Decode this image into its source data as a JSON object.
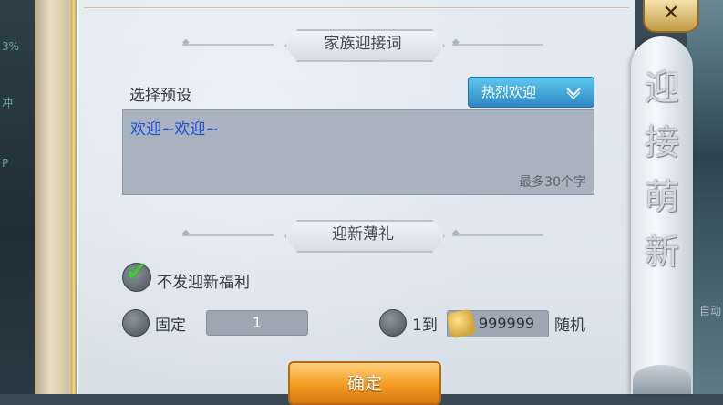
{
  "background": {
    "left_fragments": [
      "3%",
      "冲",
      "P"
    ],
    "right_fragment": "自动"
  },
  "close_glyph": "✕",
  "scroll_title": [
    "迎",
    "接",
    "萌",
    "新"
  ],
  "welcome_section": {
    "title": "家族迎接词",
    "preset_label": "选择预设",
    "preset_selected": "热烈欢迎",
    "preset_chevron": "❯",
    "message_text": "欢迎~欢迎~",
    "message_limit_hint": "最多30个字"
  },
  "gift_section": {
    "title": "迎新薄礼",
    "no_welfare_label": "不发迎新福利",
    "no_welfare_checked": true,
    "fixed_label": "固定",
    "fixed_value": "1",
    "range_label": "1到",
    "range_value": "999999",
    "random_label": "随机"
  },
  "confirm_label": "确定",
  "colors": {
    "accent_blue": "#2f86c2",
    "confirm_orange": "#f39b22",
    "message_text": "#2350d2"
  }
}
